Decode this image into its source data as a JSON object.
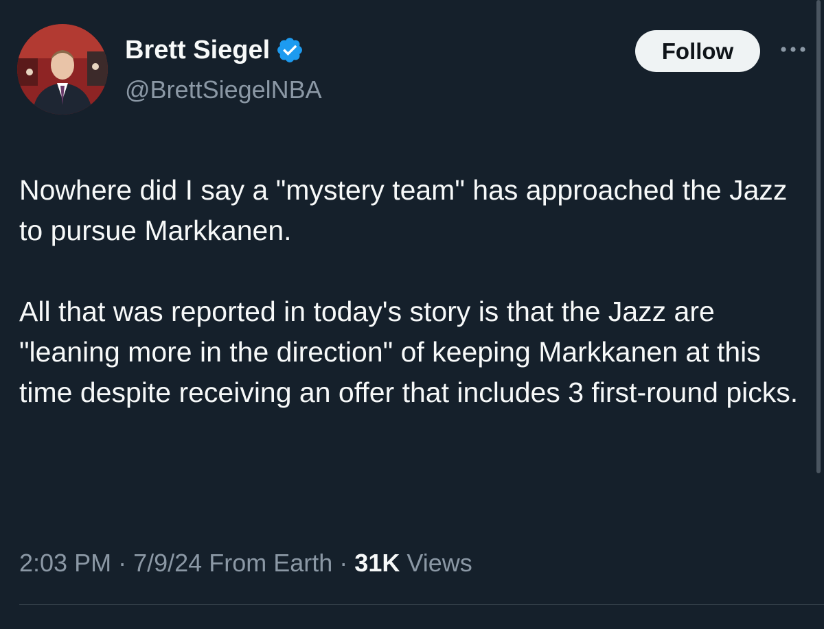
{
  "author": {
    "display_name": "Brett Siegel",
    "handle": "@BrettSiegelNBA",
    "verified": true,
    "avatar_icon": "profile-photo"
  },
  "actions": {
    "follow_label": "Follow",
    "more_icon": "more-horizontal-icon"
  },
  "tweet": {
    "paragraphs": [
      "Nowhere did I say a \"mystery team\" has approached the Jazz to pursue Markkanen.",
      "All that was reported in today's story is that the Jazz are \"leaning more in the direction\" of keeping Markkanen at this time despite receiving an offer that includes 3 first-round picks."
    ]
  },
  "meta": {
    "time": "2:03 PM",
    "separator": "·",
    "date": "7/9/24",
    "source": "From Earth",
    "views_count": "31K",
    "views_label": "Views"
  },
  "colors": {
    "background": "#15202b",
    "text_primary": "#f7f9f9",
    "text_secondary": "#8b98a5",
    "verified_blue": "#1d9bf0",
    "follow_bg": "#eff3f4"
  }
}
